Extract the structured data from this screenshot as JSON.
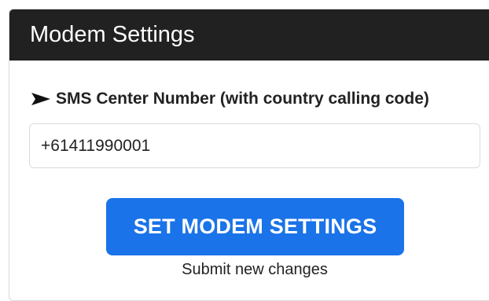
{
  "card": {
    "title": "Modem Settings"
  },
  "sms_center": {
    "label": "SMS Center Number (with country calling code)",
    "value": "+61411990001",
    "icon": "arrow-right-icon"
  },
  "actions": {
    "submit_label": "SET MODEM SETTINGS",
    "hint": "Submit new changes"
  },
  "colors": {
    "header_bg": "#212121",
    "button_bg": "#1a73e8"
  }
}
